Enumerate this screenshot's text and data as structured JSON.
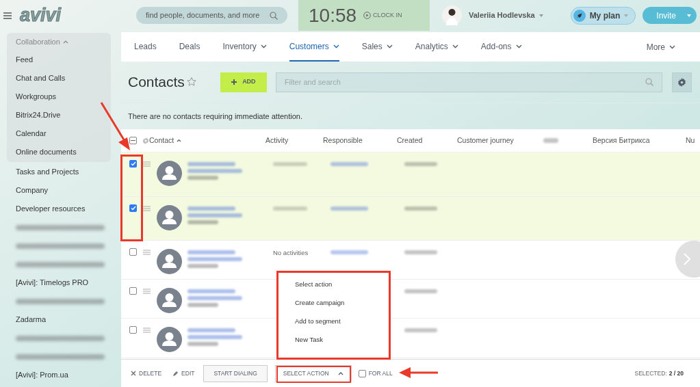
{
  "header": {
    "logo": "avivi",
    "search": {
      "placeholder": "find people, documents, and more"
    },
    "clock": {
      "time": "10:58",
      "action": "CLOCK IN"
    },
    "user": {
      "name": "Valeriia Hodlevska"
    },
    "plan_button": "My plan",
    "invite_button": "Invite"
  },
  "sidebar": {
    "section": {
      "label": "Collaboration",
      "expanded": true,
      "items": [
        {
          "kind": "link",
          "label": "Feed"
        },
        {
          "kind": "link",
          "label": "Chat and Calls"
        },
        {
          "kind": "link",
          "label": "Workgroups"
        },
        {
          "kind": "link",
          "label": "Bitrix24.Drive"
        },
        {
          "kind": "link",
          "label": "Calendar"
        },
        {
          "kind": "link",
          "label": "Online documents"
        }
      ]
    },
    "items": [
      {
        "kind": "link",
        "label": "Tasks and Projects"
      },
      {
        "kind": "link",
        "label": "Company"
      },
      {
        "kind": "link",
        "label": "Developer resources"
      },
      {
        "kind": "blurred"
      },
      {
        "kind": "blurred"
      },
      {
        "kind": "blurred"
      },
      {
        "kind": "link",
        "label": "[Avivi]: Timelogs PRO"
      },
      {
        "kind": "blurred"
      },
      {
        "kind": "link",
        "label": "Zadarma"
      },
      {
        "kind": "blurred"
      },
      {
        "kind": "blurred"
      },
      {
        "kind": "link",
        "label": "[Avivi]: Prom.ua"
      }
    ]
  },
  "nav": {
    "tabs": [
      {
        "label": "Leads",
        "selected": false,
        "has_menu": false
      },
      {
        "label": "Deals",
        "selected": false,
        "has_menu": false
      },
      {
        "label": "Inventory",
        "selected": false,
        "has_menu": true
      },
      {
        "label": "Customers",
        "selected": true,
        "has_menu": true
      },
      {
        "label": "Sales",
        "selected": false,
        "has_menu": true
      },
      {
        "label": "Analytics",
        "selected": false,
        "has_menu": true
      },
      {
        "label": "Add-ons",
        "selected": false,
        "has_menu": true
      }
    ],
    "more": "More"
  },
  "page": {
    "title": "Contacts",
    "add_button": "ADD",
    "filter": {
      "placeholder": "Filter and search"
    },
    "notice": "There are no contacts requiring immediate attention."
  },
  "table": {
    "select_all": {
      "indeterminate": true
    },
    "columns": [
      {
        "kind": "text",
        "label": "Contact",
        "sorted": true
      },
      {
        "kind": "text",
        "label": "Activity",
        "sorted": false
      },
      {
        "kind": "text",
        "label": "Responsible",
        "sorted": false
      },
      {
        "kind": "text",
        "label": "Created",
        "sorted": false
      },
      {
        "kind": "text",
        "label": "Customer journey",
        "sorted": false
      },
      {
        "kind": "blurred"
      },
      {
        "kind": "text",
        "label": "Версия Битрикса",
        "sorted": false
      },
      {
        "kind": "text",
        "label": "Nu",
        "sorted": false
      }
    ],
    "rows": [
      {
        "checked": true,
        "activity": {
          "kind": "blurred"
        }
      },
      {
        "checked": true,
        "activity": {
          "kind": "blurred"
        }
      },
      {
        "checked": false,
        "activity": {
          "kind": "text",
          "text": "No activities"
        }
      },
      {
        "checked": false,
        "activity": {
          "kind": "none"
        }
      },
      {
        "checked": false,
        "activity": {
          "kind": "none"
        }
      }
    ]
  },
  "action_menu": {
    "items": [
      "Select action",
      "Create campaign",
      "Add to segment",
      "New Task"
    ]
  },
  "footer": {
    "delete": "DELETE",
    "edit": "EDIT",
    "start_dialing": "START DIALING",
    "select_action": {
      "label": "SELECT ACTION",
      "expanded": true
    },
    "for_all": {
      "label": "FOR ALL",
      "checked": false
    },
    "selected_label": "SELECTED:",
    "selected_count": "2 / 20"
  }
}
